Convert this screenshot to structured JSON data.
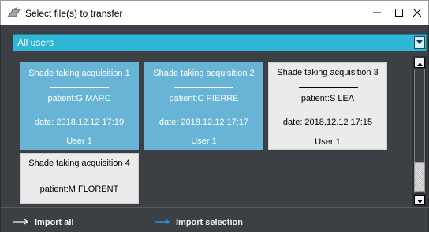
{
  "window": {
    "title": "Select file(s) to transfer",
    "controls": {
      "minimize": "minimize-icon",
      "maximize": "maximize-icon",
      "close": "close-icon"
    }
  },
  "filter": {
    "selected": "All users"
  },
  "cards": [
    {
      "title": "Shade taking acquisition 1",
      "patient": "patient:G MARC",
      "date": "date: 2018.12.12 17:19",
      "user": "User 1",
      "selected": true
    },
    {
      "title": "Shade taking acquisition 2",
      "patient": "patient:C PIERRE",
      "date": "date: 2018.12.12 17:17",
      "user": "User 1",
      "selected": true
    },
    {
      "title": "Shade taking acquisition 3",
      "patient": "patient:S LEA",
      "date": "date: 2018.12.12 17:15",
      "user": "User 1",
      "selected": false
    },
    {
      "title": "Shade taking acquisition 4",
      "patient": "patient:M FLORENT",
      "selected": false
    }
  ],
  "actions": {
    "import_all": "Import all",
    "import_selection": "Import selection"
  },
  "colors": {
    "accent": "#2eb6d6",
    "selected_card": "#67b4d6",
    "background": "#3c3f44",
    "import_selection_arrow": "#2e8fe0"
  }
}
